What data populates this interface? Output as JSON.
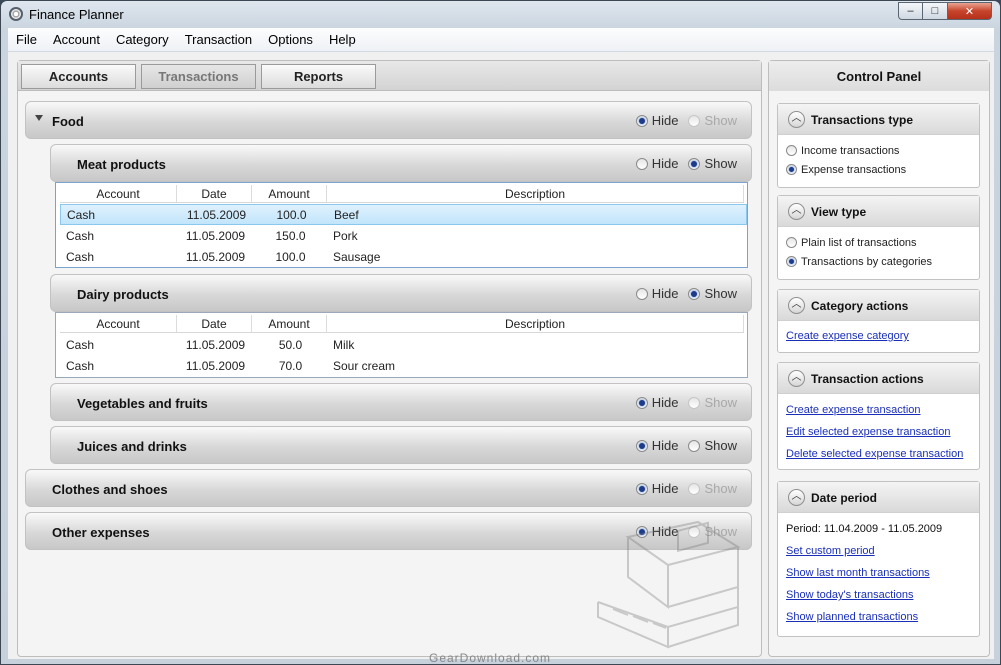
{
  "window": {
    "title": "Finance Planner",
    "controls": {
      "minimize": "–",
      "maximize": "□",
      "close": "✕"
    }
  },
  "menu": [
    "File",
    "Account",
    "Category",
    "Transaction",
    "Options",
    "Help"
  ],
  "tabs": [
    {
      "label": "Accounts"
    },
    {
      "label": "Transactions"
    },
    {
      "label": "Reports"
    }
  ],
  "radio": {
    "hide": "Hide",
    "show": "Show"
  },
  "groups": {
    "food": {
      "title": "Food",
      "selected": "Hide",
      "show_enabled": false
    },
    "meat": {
      "title": "Meat products",
      "selected": "Show",
      "show_enabled": true
    },
    "dairy": {
      "title": "Dairy products",
      "selected": "Show",
      "show_enabled": true
    },
    "veg": {
      "title": "Vegetables and fruits",
      "selected": "Hide",
      "show_enabled": false
    },
    "juice": {
      "title": "Juices and drinks",
      "selected": "Hide",
      "show_enabled": true
    },
    "clothes": {
      "title": "Clothes and shoes",
      "selected": "Hide",
      "show_enabled": false
    },
    "other": {
      "title": "Other expenses",
      "selected": "Hide",
      "show_enabled": false
    }
  },
  "columns": [
    "Account",
    "Date",
    "Amount",
    "Description"
  ],
  "meat_rows": [
    {
      "account": "Cash",
      "date": "11.05.2009",
      "amount": "100.0",
      "description": "Beef"
    },
    {
      "account": "Cash",
      "date": "11.05.2009",
      "amount": "150.0",
      "description": "Pork"
    },
    {
      "account": "Cash",
      "date": "11.05.2009",
      "amount": "100.0",
      "description": "Sausage"
    }
  ],
  "dairy_rows": [
    {
      "account": "Cash",
      "date": "11.05.2009",
      "amount": "50.0",
      "description": "Milk"
    },
    {
      "account": "Cash",
      "date": "11.05.2009",
      "amount": "70.0",
      "description": "Sour cream"
    }
  ],
  "control_panel": {
    "title": "Control Panel",
    "transactions_type": {
      "title": "Transactions type",
      "options": [
        "Income transactions",
        "Expense transactions"
      ],
      "selected": 1
    },
    "view_type": {
      "title": "View type",
      "options": [
        "Plain list of transactions",
        "Transactions by categories"
      ],
      "selected": 1
    },
    "category_actions": {
      "title": "Category actions",
      "links": [
        "Create expense category"
      ]
    },
    "transaction_actions": {
      "title": "Transaction actions",
      "links": [
        "Create expense transaction",
        "Edit selected expense transaction",
        "Delete selected expense transaction"
      ]
    },
    "date_period": {
      "title": "Date period",
      "period": "Period: 11.04.2009 - 11.05.2009",
      "links": [
        "Set custom period",
        "Show last month transactions",
        "Show today's transactions",
        "Show planned transactions"
      ]
    }
  },
  "watermark": "GearDownload.com"
}
